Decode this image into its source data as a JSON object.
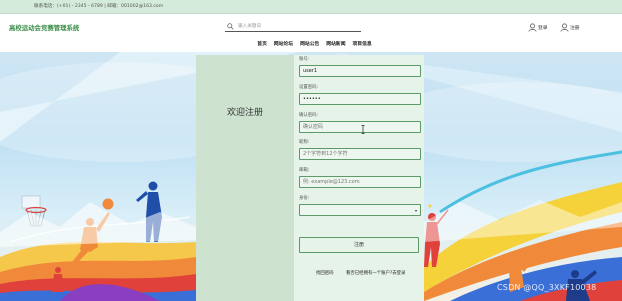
{
  "topbar": {
    "contact": "联系电话：(+01) - 2345 - 6789 | 邮箱：001002@163.com"
  },
  "header": {
    "title": "高校运动会竞赛管理系统",
    "search_placeholder": "输入关键词",
    "login_label": "登录",
    "register_label": "注册"
  },
  "nav": {
    "items": [
      "首页",
      "网站论坛",
      "网站公告",
      "网站新闻",
      "项目信息"
    ]
  },
  "form": {
    "welcome": "欢迎注册",
    "fields": [
      {
        "label": "账号:",
        "value": "user1"
      },
      {
        "label": "设置密码:",
        "value": "••••••"
      },
      {
        "label": "确认密码:",
        "value": "",
        "placeholder": "确认密码"
      },
      {
        "label": "昵称:",
        "value": "",
        "placeholder": "2个字符到12个字符"
      },
      {
        "label": "邮箱:",
        "value": "",
        "placeholder": "例: example@123.com"
      },
      {
        "label": "身份:",
        "value": ""
      }
    ],
    "submit_label": "注册",
    "back_label": "找回密码",
    "login_link": "看否已经拥有一个账户?去登录"
  },
  "watermark": "CSDN @QQ_3XKF10038",
  "colors": {
    "accent": "#3f8f4c",
    "panel_left": "#cde3cf",
    "panel_right": "#e6f3e8",
    "input_border": "#5d9a6a"
  }
}
